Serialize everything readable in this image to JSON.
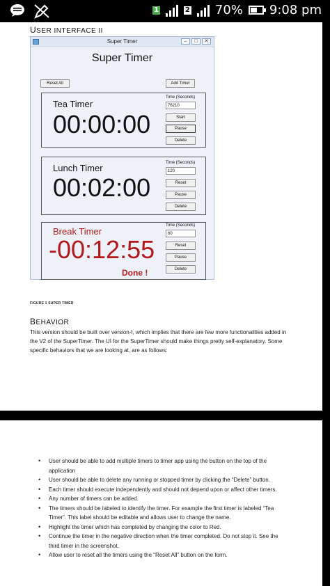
{
  "status_bar": {
    "sim1": "1",
    "sim2": "2",
    "battery": "70%",
    "time": "9:08 pm"
  },
  "doc": {
    "section1_cap": "U",
    "section1_rest": "SER INTERFACE II",
    "caption": "FIGURE 1 SUPER TIMER",
    "section2_cap": "B",
    "section2_rest": "EHAVIOR",
    "paragraph": "This version should be built over version-I, which implies that there are few more functionalities added in the V2 of the SuperTimer. The UI for the SuperTimer should make things pretty self-explanatory. Some specific behaviors that we are looking at, are as follows:",
    "bullets": [
      "User should be able to add multiple timers to timer app using the button on the top of the application",
      "User should be able to delete any running or stopped timer by clicking the “Delete” button.",
      "Each timer should execute independently and should not depend upon or affect other timers.",
      "Any number of timers can be added.",
      "The timers should be labeled to identify the timer. For example the first timer is labeled “Tea Timer”. This label should be editable and allows user to change the name.",
      "Highlight the timer which has completed by changing the color to Red.",
      "Continue the timer in the negative direction when the timer completed. Do not stop it. See the third timer in the screenshot.",
      "Allow user to reset all the timers using the “Reset All” button on the form."
    ]
  },
  "window": {
    "title": "Super Timer",
    "controls": {
      "minimize": "–",
      "maximize": "□",
      "close": "✕"
    },
    "app_title": "Super Timer",
    "reset_all": "Reset All",
    "add_timer": "Add Timer",
    "seconds_label": "Time (Seconds)",
    "timers": [
      {
        "name": "Tea Timer",
        "time": "00:00:00",
        "seconds": "76210",
        "buttons": [
          "Start",
          "Pause",
          "Delete"
        ],
        "done": ""
      },
      {
        "name": "Lunch Timer",
        "time": "00:02:00",
        "seconds": "120",
        "buttons": [
          "Reset",
          "Pause",
          "Delete"
        ],
        "done": ""
      },
      {
        "name": "Break Timer",
        "time": "-00:12:55",
        "seconds": "60",
        "buttons": [
          "Reset",
          "Pause",
          "Delete"
        ],
        "done": "Done !"
      }
    ]
  },
  "colors": {
    "done_red": "#b1191b",
    "window_bg": "#eef2f8"
  }
}
